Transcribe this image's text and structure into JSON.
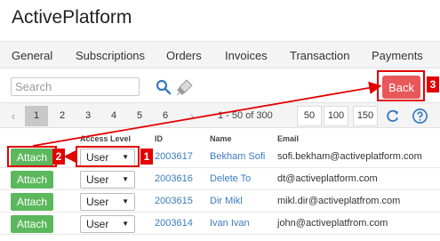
{
  "app": {
    "title": "ActivePlatform"
  },
  "tabs": [
    "General",
    "Subscriptions",
    "Orders",
    "Invoices",
    "Transaction",
    "Payments"
  ],
  "search": {
    "placeholder": "Search",
    "value": ""
  },
  "back_label": "Back",
  "pager": {
    "pages": [
      "1",
      "2",
      "3",
      "4",
      "5",
      "6"
    ],
    "active_page": "1",
    "prev_symbol": "‹",
    "next_symbol": "›",
    "range_text": "1 - 50 of 300",
    "page_sizes": [
      "50",
      "100",
      "150"
    ]
  },
  "columns": {
    "access_level": "Access Level",
    "id": "ID",
    "name": "Name",
    "email": "Email"
  },
  "rows": [
    {
      "attach": "Attach",
      "access": "User",
      "id": "2003617",
      "name": "Bekham Sofi",
      "email": "sofi.bekham@activeplatform.com"
    },
    {
      "attach": "Attach",
      "access": "User",
      "id": "2003616",
      "name": "Delete To",
      "email": "dt@activeplatform.com"
    },
    {
      "attach": "Attach",
      "access": "User",
      "id": "2003615",
      "name": "Dir Mikl",
      "email": "mikl.dir@activeplatfrom.com"
    },
    {
      "attach": "Attach",
      "access": "User",
      "id": "2003614",
      "name": "Ivan Ivan",
      "email": "john@activeplatfrom.com"
    }
  ],
  "callouts": [
    "1",
    "2",
    "3"
  ],
  "colors": {
    "accent_red": "#e20000",
    "back_button": "#e8585a",
    "attach_button": "#5cb85c",
    "link": "#3a7bbf"
  }
}
